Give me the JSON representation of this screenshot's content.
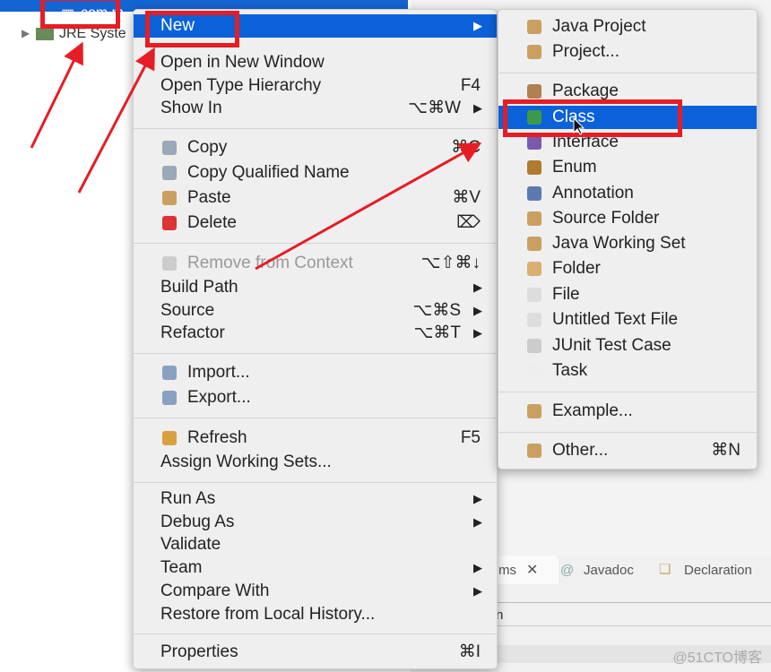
{
  "tree": {
    "selected_item": "com.m",
    "jre_item": "JRE Syste"
  },
  "main_menu": [
    {
      "label": "New",
      "arrow": true,
      "highlight": true
    },
    {
      "sep": true
    },
    {
      "label": "Open in New Window"
    },
    {
      "label": "Open Type Hierarchy",
      "shortcut": "F4"
    },
    {
      "label": "Show In",
      "shortcut": "⌥⌘W",
      "arrow": true
    },
    {
      "sep": true
    },
    {
      "label": "Copy",
      "shortcut": "⌘C",
      "icon": "copy-icon"
    },
    {
      "label": "Copy Qualified Name",
      "icon": "copy-qualified-icon"
    },
    {
      "label": "Paste",
      "shortcut": "⌘V",
      "icon": "paste-icon"
    },
    {
      "label": "Delete",
      "shortcut": "⌦",
      "icon": "delete-icon"
    },
    {
      "sep": true
    },
    {
      "label": "Remove from Context",
      "shortcut": "⌥⇧⌘↓",
      "icon": "remove-context-icon",
      "disabled": true
    },
    {
      "label": "Build Path",
      "arrow": true
    },
    {
      "label": "Source",
      "shortcut": "⌥⌘S",
      "arrow": true
    },
    {
      "label": "Refactor",
      "shortcut": "⌥⌘T",
      "arrow": true
    },
    {
      "sep": true
    },
    {
      "label": "Import...",
      "icon": "import-icon"
    },
    {
      "label": "Export...",
      "icon": "export-icon"
    },
    {
      "sep": true
    },
    {
      "label": "Refresh",
      "shortcut": "F5",
      "icon": "refresh-icon"
    },
    {
      "label": "Assign Working Sets..."
    },
    {
      "sep": true
    },
    {
      "label": "Run As",
      "arrow": true
    },
    {
      "label": "Debug As",
      "arrow": true
    },
    {
      "label": "Validate"
    },
    {
      "label": "Team",
      "arrow": true
    },
    {
      "label": "Compare With",
      "arrow": true
    },
    {
      "label": "Restore from Local History..."
    },
    {
      "sep": true
    },
    {
      "label": "Properties",
      "shortcut": "⌘I"
    }
  ],
  "new_submenu": [
    {
      "label": "Java Project",
      "icon": "java-project-icon"
    },
    {
      "label": "Project...",
      "icon": "project-icon"
    },
    {
      "sep": true
    },
    {
      "label": "Package",
      "icon": "package-icon"
    },
    {
      "label": "Class",
      "icon": "class-icon",
      "highlight": true
    },
    {
      "label": "Interface",
      "icon": "interface-icon"
    },
    {
      "label": "Enum",
      "icon": "enum-icon"
    },
    {
      "label": "Annotation",
      "icon": "annotation-icon"
    },
    {
      "label": "Source Folder",
      "icon": "source-folder-icon"
    },
    {
      "label": "Java Working Set",
      "icon": "working-set-icon"
    },
    {
      "label": "Folder",
      "icon": "folder-icon"
    },
    {
      "label": "File",
      "icon": "file-icon"
    },
    {
      "label": "Untitled Text File",
      "icon": "text-file-icon"
    },
    {
      "label": "JUnit Test Case",
      "icon": "junit-icon"
    },
    {
      "label": "Task",
      "icon": "task-icon"
    },
    {
      "sep": true
    },
    {
      "label": "Example...",
      "icon": "example-icon"
    },
    {
      "sep": true
    },
    {
      "label": "Other...",
      "shortcut": "⌘N",
      "icon": "other-icon"
    }
  ],
  "bottom_panel": {
    "tab_problems": "ms",
    "tab_javadoc": "Javadoc",
    "tab_declaration": "Declaration",
    "row_text": "n"
  },
  "watermark": "@51CTO博客",
  "colors": {
    "highlight": "#0b61d9",
    "annotation_red": "#e51d25"
  }
}
